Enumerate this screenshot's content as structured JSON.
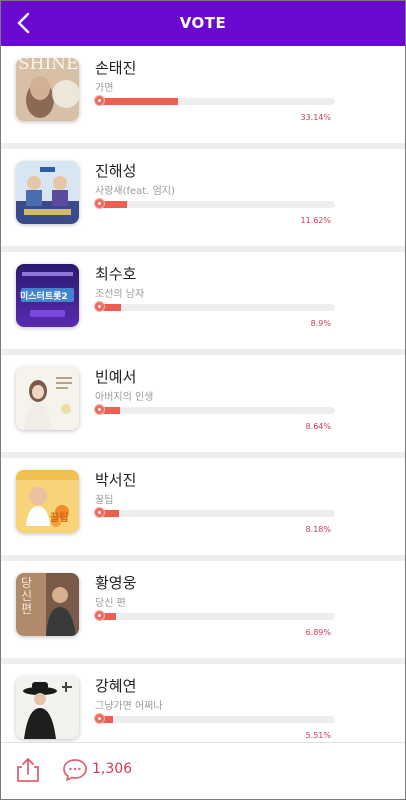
{
  "header": {
    "title": "VOTE",
    "back_icon": "chevron-left-icon"
  },
  "accent_color": "#6a0ad0",
  "bar_color": "#ee5f52",
  "percent_color": "#d13a5a",
  "items": [
    {
      "artist": "손태진",
      "song": "가면",
      "percent_label": "33.14%",
      "percent": 33.14,
      "cover_text": "SHINE"
    },
    {
      "artist": "진해성",
      "song": "사랑새(feat. 엄지)",
      "percent_label": "11.62%",
      "percent": 11.62,
      "cover_text": ""
    },
    {
      "artist": "최수호",
      "song": "조선의 남자",
      "percent_label": "8.9%",
      "percent": 8.9,
      "cover_text": "미스터트롯2"
    },
    {
      "artist": "빈예서",
      "song": "아버지의 인생",
      "percent_label": "8.64%",
      "percent": 8.64,
      "cover_text": ""
    },
    {
      "artist": "박서진",
      "song": "꿀팁",
      "percent_label": "8.18%",
      "percent": 8.18,
      "cover_text": "꿀팁"
    },
    {
      "artist": "황영웅",
      "song": "당신 편",
      "percent_label": "6.89%",
      "percent": 6.89,
      "cover_text": "당신편"
    },
    {
      "artist": "강혜연",
      "song": "그냥가면 어쩌나",
      "percent_label": "5.51%",
      "percent": 5.51,
      "cover_text": ""
    }
  ],
  "footer": {
    "share_icon": "share-icon",
    "comment_icon": "comment-icon",
    "comment_count": "1,306"
  }
}
